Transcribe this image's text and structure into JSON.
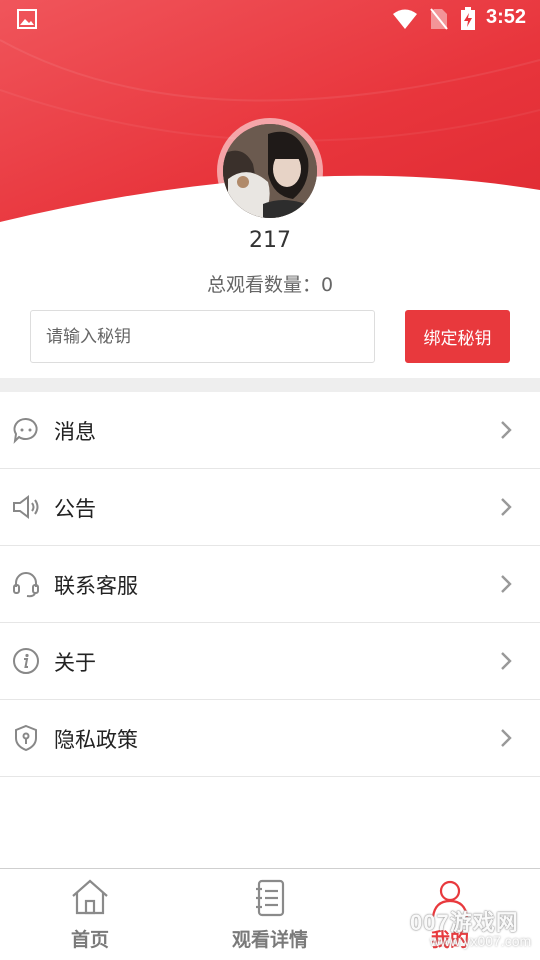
{
  "status_bar": {
    "time": "3:52",
    "icons": [
      "gallery-icon",
      "wifi-icon",
      "no-sim-icon",
      "battery-charging-icon"
    ]
  },
  "profile": {
    "username": "217",
    "view_count_label": "总观看数量：0"
  },
  "secret_key": {
    "placeholder": "请输入秘钥",
    "value": "",
    "bind_label": "绑定秘钥"
  },
  "menu": {
    "items": [
      {
        "label": "消息",
        "icon": "message-icon"
      },
      {
        "label": "公告",
        "icon": "speaker-icon"
      },
      {
        "label": "联系客服",
        "icon": "headset-icon"
      },
      {
        "label": "关于",
        "icon": "info-icon"
      },
      {
        "label": "隐私政策",
        "icon": "shield-icon"
      }
    ]
  },
  "bottom_nav": {
    "items": [
      {
        "label": "首页",
        "icon": "home-icon",
        "active": false
      },
      {
        "label": "观看详情",
        "icon": "notebook-icon",
        "active": false
      },
      {
        "label": "我的",
        "icon": "user-icon",
        "active": true
      }
    ]
  },
  "watermark": {
    "main": "007游戏网",
    "url": "www.yx007.com"
  },
  "colors": {
    "accent": "#e8393d",
    "header_gradient_start": "#f25a5f",
    "header_gradient_end": "#e32d35",
    "inactive_nav": "#7a7a7a"
  }
}
